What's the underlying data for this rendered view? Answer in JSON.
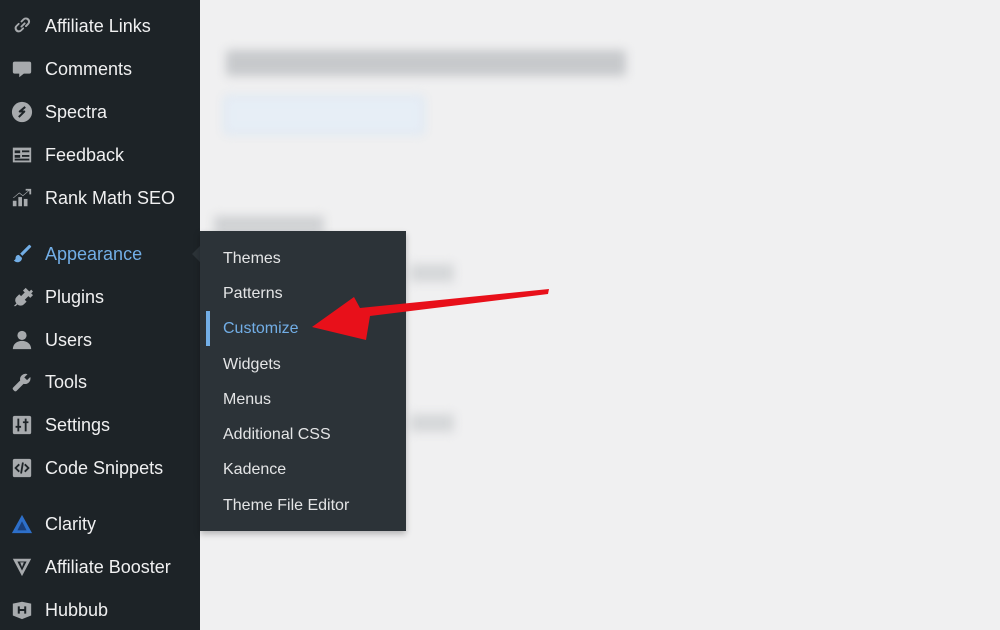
{
  "sidebar": {
    "items": [
      {
        "label": "Affiliate Links",
        "icon": "link-icon"
      },
      {
        "label": "Comments",
        "icon": "comment-icon"
      },
      {
        "label": "Spectra",
        "icon": "spectra-icon"
      },
      {
        "label": "Feedback",
        "icon": "feedback-icon"
      },
      {
        "label": "Rank Math SEO",
        "icon": "rank-math-icon"
      },
      {
        "label": "Appearance",
        "icon": "paintbrush-icon",
        "active": true
      },
      {
        "label": "Plugins",
        "icon": "plug-icon"
      },
      {
        "label": "Users",
        "icon": "user-icon"
      },
      {
        "label": "Tools",
        "icon": "wrench-icon"
      },
      {
        "label": "Settings",
        "icon": "settings-sliders-icon"
      },
      {
        "label": "Code Snippets",
        "icon": "code-icon"
      },
      {
        "label": "Clarity",
        "icon": "clarity-icon"
      },
      {
        "label": "Affiliate Booster",
        "icon": "affiliate-booster-icon"
      },
      {
        "label": "Hubbub",
        "icon": "hubbub-icon"
      }
    ]
  },
  "submenu": {
    "items": [
      {
        "label": "Themes"
      },
      {
        "label": "Patterns"
      },
      {
        "label": "Customize",
        "current": true
      },
      {
        "label": "Widgets"
      },
      {
        "label": "Menus"
      },
      {
        "label": "Additional CSS"
      },
      {
        "label": "Kadence"
      },
      {
        "label": "Theme File Editor"
      }
    ]
  },
  "annotation": {
    "arrow_color": "#e8101a",
    "points_to": "Customize"
  },
  "colors": {
    "sidebar_bg": "#1d2327",
    "submenu_bg": "#2c3338",
    "accent": "#72aee6",
    "page_bg": "#f0f0f1"
  }
}
